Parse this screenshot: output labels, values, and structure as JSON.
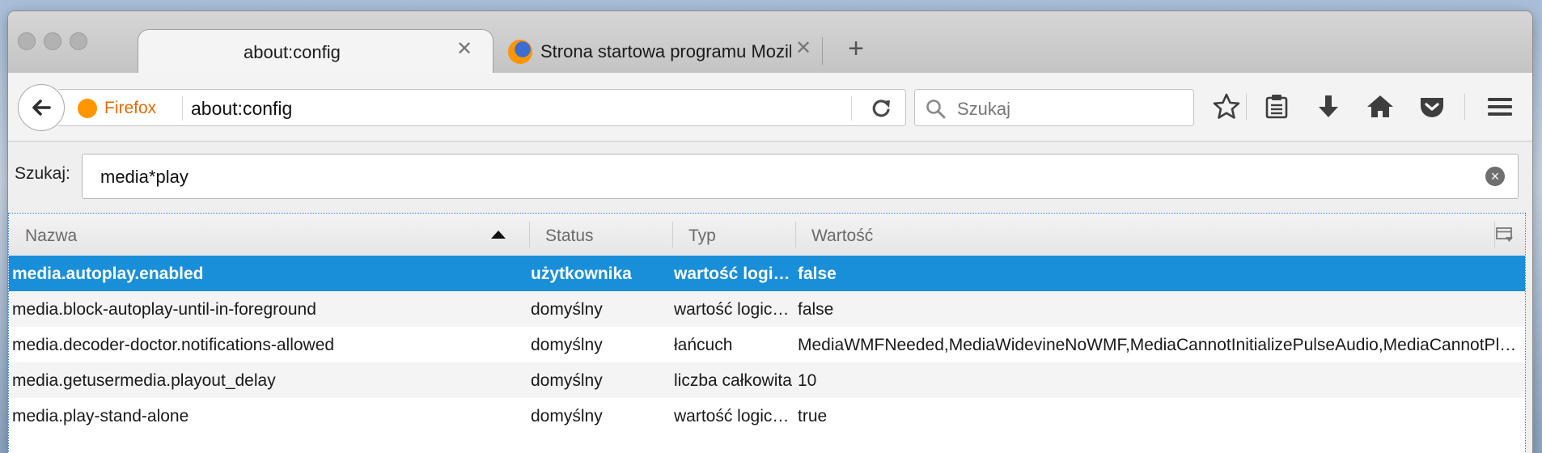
{
  "tabs": [
    {
      "title": "about:config",
      "active": true
    },
    {
      "title": "Strona startowa programu Mozilla Firefox",
      "active": false
    }
  ],
  "navbar": {
    "identity_label": "Firefox",
    "url": "about:config",
    "search_placeholder": "Szukaj"
  },
  "config": {
    "filter_label": "Szukaj:",
    "filter_value": "media*play",
    "columns": [
      "Nazwa",
      "Status",
      "Typ",
      "Wartość"
    ],
    "sort_column": "Nazwa",
    "sort_direction": "ascending",
    "rows": [
      {
        "name": "media.autoplay.enabled",
        "status": "użytkownika",
        "type": "wartość logiczna",
        "value": "false",
        "selected": true
      },
      {
        "name": "media.block-autoplay-until-in-foreground",
        "status": "domyślny",
        "type": "wartość logiczna",
        "value": "false"
      },
      {
        "name": "media.decoder-doctor.notifications-allowed",
        "status": "domyślny",
        "type": "łańcuch",
        "value": "MediaWMFNeeded,MediaWidevineNoWMF,MediaCannotInitializePulseAudio,MediaCannotPlayNoDecoders"
      },
      {
        "name": "media.getusermedia.playout_delay",
        "status": "domyślny",
        "type": "liczba całkowita",
        "value": "10"
      },
      {
        "name": "media.play-stand-alone",
        "status": "domyślny",
        "type": "wartość logiczna",
        "value": "true"
      }
    ]
  },
  "colors": {
    "selection": "#1a8fd9",
    "firefox_orange": "#e66a00"
  },
  "icons": [
    "back-arrow-icon",
    "firefox-icon",
    "reload-icon",
    "search-icon",
    "bookmark-star-icon",
    "reading-list-icon",
    "download-icon",
    "home-icon",
    "pocket-icon",
    "menu-icon",
    "clear-icon",
    "column-picker-icon",
    "tab-close-icon",
    "new-tab-icon"
  ]
}
